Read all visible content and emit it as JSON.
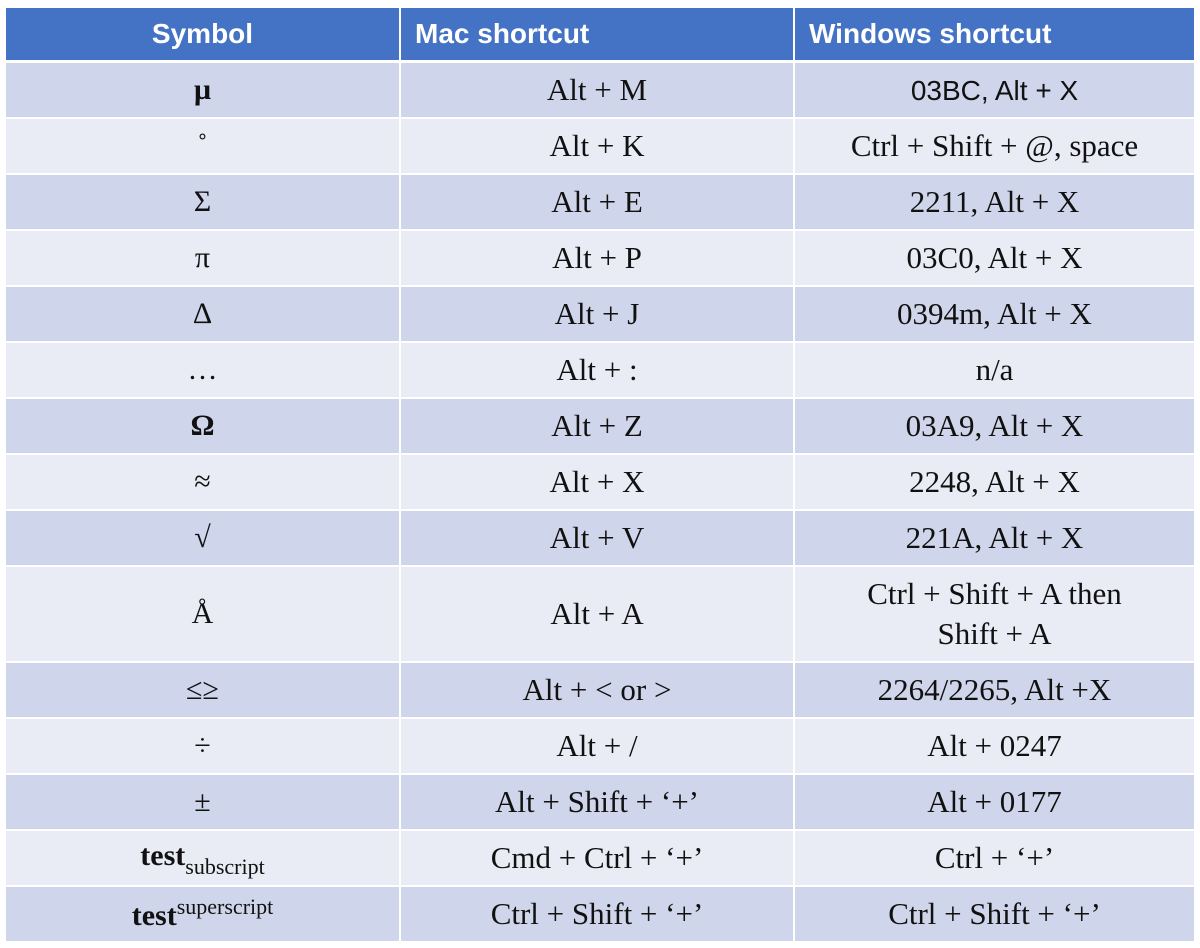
{
  "table": {
    "headers": [
      "Symbol",
      "Mac shortcut",
      "Windows shortcut"
    ],
    "rows": [
      {
        "symbol": "µ",
        "mac": "Alt + M",
        "windows": "03BC, Alt + X"
      },
      {
        "symbol": "˚",
        "mac": "Alt + K",
        "windows": "Ctrl + Shift + @, space"
      },
      {
        "symbol": "Σ",
        "mac": "Alt + E",
        "windows": "2211, Alt + X"
      },
      {
        "symbol": "π",
        "mac": "Alt + P",
        "windows": "03C0, Alt + X"
      },
      {
        "symbol": "Δ",
        "mac": "Alt + J",
        "windows": "0394m, Alt + X"
      },
      {
        "symbol": "…",
        "mac": "Alt + :",
        "windows": "n/a"
      },
      {
        "symbol": "Ω",
        "mac": "Alt + Z",
        "windows": "03A9, Alt + X"
      },
      {
        "symbol": "≈",
        "mac": "Alt + X",
        "windows": "2248, Alt + X"
      },
      {
        "symbol": "√",
        "mac": "Alt + V",
        "windows": "221A, Alt + X"
      },
      {
        "symbol": "Å",
        "mac": "Alt + A",
        "windows_lines": [
          "Ctrl + Shift + A then",
          "Shift + A"
        ]
      },
      {
        "symbol": "≤≥",
        "mac": "Alt + < or >",
        "windows": "2264/2265, Alt +X"
      },
      {
        "symbol": "÷",
        "mac": "Alt + /",
        "windows": "Alt + 0247"
      },
      {
        "symbol": "±",
        "mac": "Alt + Shift + ‘+’",
        "windows": "Alt + 0177"
      },
      {
        "symbol_base": "test",
        "symbol_sub": "subscript",
        "mac": "Cmd + Ctrl + ‘+’",
        "windows": "Ctrl + ‘+’"
      },
      {
        "symbol_base": "test",
        "symbol_sup": "superscript",
        "mac": "Ctrl + Shift + ‘+’",
        "windows": "Ctrl + Shift + ‘+’"
      }
    ]
  },
  "colors": {
    "header_bg": "#4472c4",
    "row_band_dark": "#cfd5ea",
    "row_band_light": "#e9ebf5"
  }
}
